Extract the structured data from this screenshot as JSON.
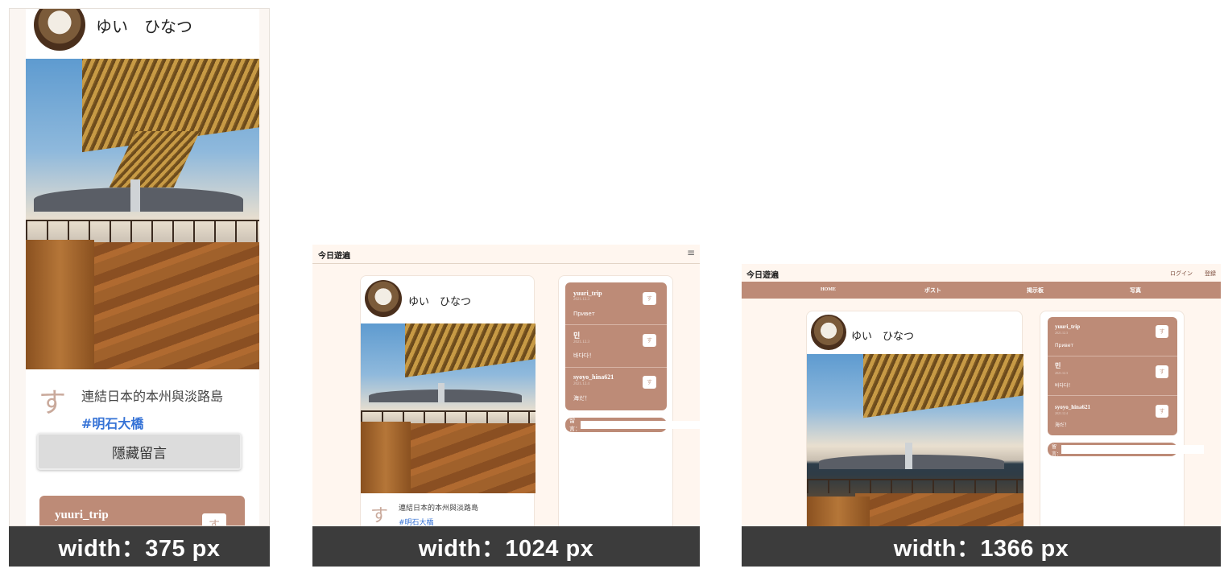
{
  "profile": {
    "username": "ゆい　ひなつ"
  },
  "post": {
    "badge": "す",
    "caption": "連結日本的本州與淡路島",
    "hashtag": "#明石大橋",
    "hide_comments_label": "隱藏留言"
  },
  "site": {
    "logo": "今日遊遍",
    "menu_icon": "≡",
    "login_label": "ログイン",
    "register_label": "登録",
    "nav": [
      "HOME",
      "ポスト",
      "掲示板",
      "写真"
    ]
  },
  "comments": [
    {
      "user": "yuuri_trip",
      "date": "2021.12.3",
      "text": "Привет",
      "badge": "す"
    },
    {
      "user": "민",
      "date": "2021.12.3",
      "text": "바다다！",
      "badge": "す"
    },
    {
      "user": "syoyo_hina621",
      "date": "2021.12.4",
      "text": "海だ！",
      "badge": "す"
    }
  ],
  "reply": {
    "label": "留言："
  },
  "captions": {
    "mobile": "width：375 px",
    "tablet": "width：1024 px",
    "desktop": "width：1366 px"
  },
  "colors": {
    "accent": "#bd8b77",
    "page_bg": "#fff6ef",
    "caption_bg": "#3c3c3c",
    "link": "#3673d6"
  }
}
